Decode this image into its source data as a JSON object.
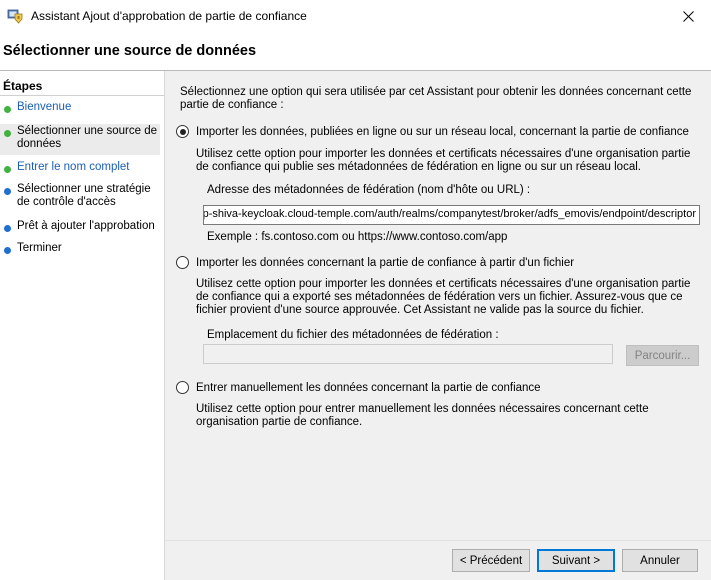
{
  "window": {
    "title": "Assistant Ajout d'approbation de partie de confiance",
    "close_icon": "close-icon"
  },
  "header": {
    "title": "Sélectionner une source de données"
  },
  "steps": {
    "heading": "Étapes",
    "items": [
      {
        "label": "Bienvenue",
        "status": "green",
        "style": "link"
      },
      {
        "label": "Sélectionner une source de données",
        "status": "green",
        "style": "current"
      },
      {
        "label": "Entrer le nom complet",
        "status": "green",
        "style": "link"
      },
      {
        "label": "Sélectionner une stratégie de contrôle d'accès",
        "status": "blue",
        "style": "plain"
      },
      {
        "label": "Prêt à ajouter l'approbation",
        "status": "blue",
        "style": "plain"
      },
      {
        "label": "Terminer",
        "status": "blue",
        "style": "plain"
      }
    ]
  },
  "main": {
    "intro": "Sélectionnez une option qui sera utilisée par cet Assistant pour obtenir les données concernant cette partie de confiance :",
    "option_online": {
      "label": "Importer les données, publiées en ligne ou sur un réseau local, concernant la partie de confiance",
      "selected": true,
      "description": "Utilisez cette option pour importer les données et certificats nécessaires d'une organisation partie de confiance qui publie ses métadonnées de fédération en ligne ou sur un réseau local.",
      "field_label": "Adresse des métadonnées de fédération (nom d'hôte ou URL) :",
      "field_value": "https://p-shiva-keycloak.cloud-temple.com/auth/realms/companytest/broker/adfs_emovis/endpoint/descriptor",
      "example": "Exemple : fs.contoso.com ou https://www.contoso.com/app"
    },
    "option_file": {
      "label": "Importer les données concernant la partie de confiance à partir d'un fichier",
      "selected": false,
      "description": "Utilisez cette option pour importer les données et certificats nécessaires d'une organisation partie de confiance qui a exporté ses métadonnées de fédération vers un fichier. Assurez-vous que ce fichier provient d'une source approuvée. Cet Assistant ne valide pas la source du fichier.",
      "field_label": "Emplacement du fichier des métadonnées de fédération :",
      "field_value": "",
      "browse_label": "Parcourir..."
    },
    "option_manual": {
      "label": "Entrer manuellement les données concernant la partie de confiance",
      "selected": false,
      "description": "Utilisez cette option pour entrer manuellement les données nécessaires concernant cette organisation partie de confiance."
    }
  },
  "buttons": {
    "previous": "< Précédent",
    "next": "Suivant >",
    "cancel": "Annuler"
  }
}
